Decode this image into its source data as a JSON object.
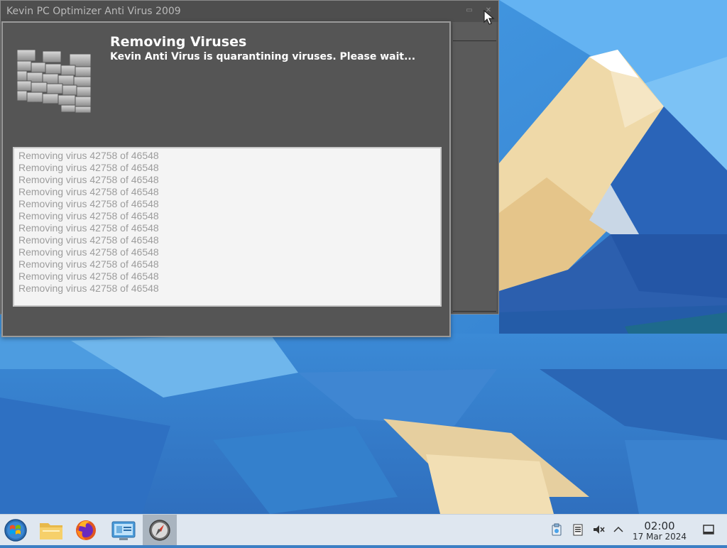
{
  "main_window": {
    "title": "Kevin PC Optimizer Anti Virus 2009"
  },
  "dialog": {
    "heading": "Removing Viruses",
    "subheading": "Kevin Anti Virus is quarantining viruses. Please wait...",
    "log_lines": [
      "Removing virus 42758 of 46548",
      "Removing virus 42758 of 46548",
      "Removing virus 42758 of 46548",
      "Removing virus 42758 of 46548",
      "Removing virus 42758 of 46548",
      "Removing virus 42758 of 46548",
      "Removing virus 42758 of 46548",
      "Removing virus 42758 of 46548",
      "Removing virus 42758 of 46548",
      "Removing virus 42758 of 46548",
      "Removing virus 42758 of 46548",
      "Removing virus 42758 of 46548"
    ]
  },
  "taskbar": {
    "apps": [
      {
        "name": "start-menu-icon"
      },
      {
        "name": "file-manager-icon"
      },
      {
        "name": "firefox-icon"
      },
      {
        "name": "system-settings-icon"
      },
      {
        "name": "compass-app-icon",
        "active": true
      }
    ],
    "tray": [
      "clipboard-icon",
      "notes-icon",
      "volume-muted-icon",
      "chevron-up-icon"
    ],
    "clock": {
      "time": "02:00",
      "date": "17 Mar 2024"
    }
  },
  "colors": {
    "window_bg": "#555555",
    "log_bg": "#f4f4f4",
    "log_text": "#9c9c9c",
    "taskbar_bg": "#dfe7f0"
  }
}
